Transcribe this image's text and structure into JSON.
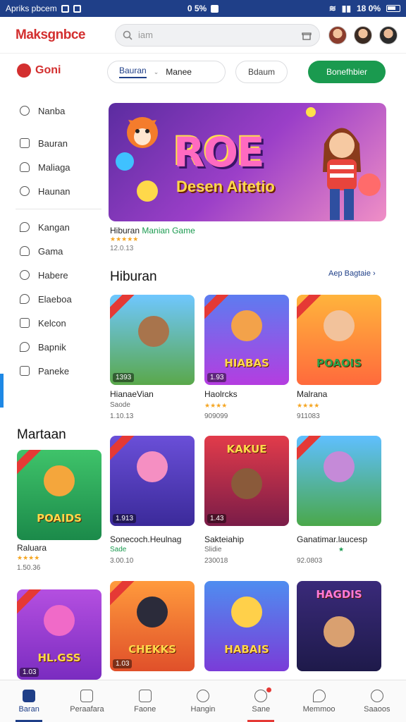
{
  "statusbar": {
    "left_text": "Apriks pbcem",
    "mid_text": "0 5%",
    "right_text": "18 0%"
  },
  "header": {
    "logo": "Maksgnbce",
    "search_placeholder": "iam"
  },
  "filter": {
    "brand": "Goni",
    "seg_active": "Bauran",
    "seg_other": "Manee",
    "pill": "Bdaum",
    "cta": "Bonefhbier"
  },
  "sidebar": {
    "group1": [
      "Nanba",
      "Bauran",
      "Maliaga",
      "Haunan"
    ],
    "group2": [
      "Kangan",
      "Gama",
      "Habere",
      "Elaeboa",
      "Kelcon",
      "Bapnik",
      "Paneke"
    ]
  },
  "hero": {
    "title": "ROE",
    "subtitle": "Desen Aitetio",
    "caption_a": "Hiburan",
    "caption_b": "Manian Game",
    "rating": "★★★★★",
    "meta": "12.0.13"
  },
  "sections": {
    "hiburan": {
      "title": "Hiburan",
      "see_all": "Aep Bagtaie ›"
    },
    "martaan": {
      "title": "Martaan"
    }
  },
  "cards": [
    {
      "title": "",
      "badge": "1393",
      "name": "HianaeVian",
      "stars": "",
      "sub": "Saode",
      "count": "1.10.13"
    },
    {
      "title": "HIABAS",
      "badge": "1.93",
      "name": "Haolrcks",
      "stars": "★★★★",
      "sub": "",
      "count": "909099"
    },
    {
      "title": "POAOIS",
      "badge": "",
      "name": "Malrana",
      "stars": "★★★★",
      "sub": "",
      "count": "911083"
    },
    {
      "title": "POAIDS",
      "badge": "",
      "name": "Raluara",
      "stars": "★★★★",
      "sub": "",
      "count": "1.50.36"
    },
    {
      "title": "",
      "badge": "1.913",
      "name": "Sonecoch.Heulnag",
      "stars": "",
      "sub": "Sade",
      "count": "3.00.10"
    },
    {
      "title": "KAKUE",
      "badge": "1.43",
      "name": "Sakteiahip",
      "stars": "",
      "sub": "Slidie",
      "count": "230018"
    },
    {
      "title": "",
      "badge": "",
      "name": "Ganatimar.laucesp",
      "stars": "★",
      "sub": "",
      "count": "92.0803"
    },
    {
      "title": "HL.GSS",
      "badge": "1.03",
      "name": "",
      "stars": "",
      "sub": "",
      "count": ""
    },
    {
      "title": "CHEKKS",
      "badge": "1.03",
      "name": "",
      "stars": "",
      "sub": "",
      "count": ""
    },
    {
      "title": "HABAIS",
      "badge": "",
      "name": "",
      "stars": "",
      "sub": "",
      "count": ""
    },
    {
      "title": "HAGDIS",
      "badge": "",
      "name": "",
      "stars": "",
      "sub": "",
      "count": ""
    }
  ],
  "bottomnav": [
    "Baran",
    "Peraafara",
    "Faone",
    "Hangin",
    "Sane",
    "Memmoo",
    "Saaoos"
  ],
  "colors": {
    "brand_red": "#d32f2f",
    "brand_blue": "#1f3f88",
    "cta_green": "#1a9a4f",
    "star": "#f5a623"
  }
}
